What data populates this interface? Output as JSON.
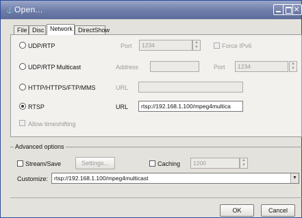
{
  "window": {
    "title": "Open...",
    "title_icon": "⚓"
  },
  "tabs": [
    {
      "label": "File"
    },
    {
      "label": "Disc"
    },
    {
      "label": "Network",
      "active": true
    },
    {
      "label": "DirectShow"
    }
  ],
  "network": {
    "udp": {
      "label": "UDP/RTP",
      "port_label": "Port",
      "port_value": "1234",
      "force_ipv6_label": "Force IPv6"
    },
    "udp_multicast": {
      "label": "UDP/RTP Multicast",
      "address_label": "Address",
      "address_value": "",
      "port_label": "Port",
      "port_value": "1234"
    },
    "http": {
      "label": "HTTP/HTTPS/FTP/MMS",
      "url_label": "URL",
      "url_value": ""
    },
    "rtsp": {
      "label": "RTSP",
      "selected": true,
      "url_label": "URL",
      "url_value": "rtsp://192.168.1.100/mpeg4multica"
    },
    "allow_timeshift_label": "Allow timeshifting"
  },
  "advanced": {
    "title": "Advanced options",
    "stream_save_label": "Stream/Save",
    "settings_label": "Settings...",
    "caching_label": "Caching",
    "caching_value": "1200",
    "customize_label": "Customize:",
    "customize_value": "rtsp://192.168.1.100/mpeg4multicast"
  },
  "buttons": {
    "ok": "OK",
    "cancel": "Cancel"
  }
}
